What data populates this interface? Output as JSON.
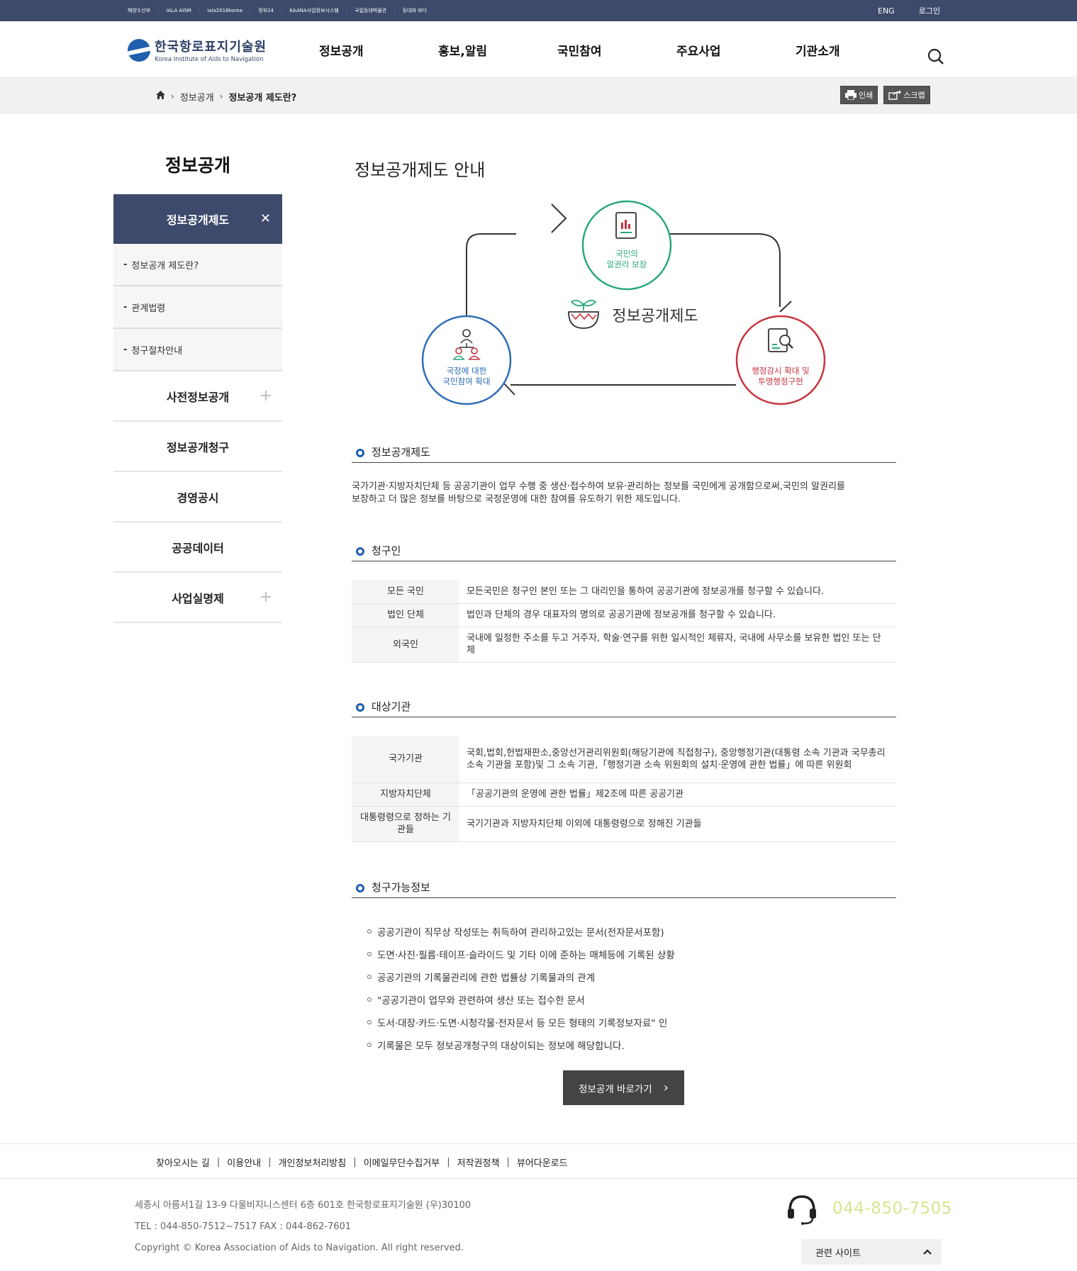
{
  "topbar": {
    "links": [
      "해양수산부",
      "IALA AISM",
      "iala2018korea",
      "정부24",
      "KAANA사업정보시스템",
      "국립등대박물관",
      "등대와 바다"
    ],
    "eng": "ENG",
    "login": "로그인"
  },
  "header": {
    "logo_ko": "한국항로표지기술원",
    "logo_en": "Korea Institute of Aids to Navigation",
    "nav": [
      "정보공개",
      "홍보,알림",
      "국민참여",
      "주요사업",
      "기관소개"
    ]
  },
  "breadcrumb": {
    "items": [
      "정보공개",
      "정보공개 제도란?"
    ],
    "print": "인쇄",
    "scrap": "스크랩"
  },
  "lnb": {
    "title": "정보공개",
    "active": "정보공개제도",
    "subs": [
      "정보공개 제도란?",
      "관계법령",
      "청구절차안내"
    ],
    "mains": [
      {
        "label": "사전정보공개",
        "expand": true
      },
      {
        "label": "정보공개청구",
        "expand": false
      },
      {
        "label": "경영공시",
        "expand": false
      },
      {
        "label": "공공데이터",
        "expand": false
      },
      {
        "label": "사업실명제",
        "expand": true
      }
    ]
  },
  "content": {
    "title": "정보공개제도 안내",
    "diagram": {
      "center": "정보공개제도",
      "top": [
        "국민의",
        "알권리 보장"
      ],
      "left": [
        "국정에 대한",
        "국민참여 확대"
      ],
      "right": [
        "행정감시 확대 및",
        "투명행정구현"
      ],
      "colors": {
        "top": "#2aa87a",
        "left": "#2d6db5",
        "right": "#c8333f",
        "line": "#333333"
      }
    },
    "sec1": {
      "title": "정보공개제도",
      "text_line1": "국가기관·지방자치단체 등 공공기관이 업무 수행 중 생산·접수하여 보유·관리하는 정보를 국민에게 공개함으로써,국민의 알권리를",
      "text_line2": "보장하고 더 많은 정보를 바탕으로 국정운영에 대한 참여를 유도하기 위한 제도입니다."
    },
    "sec2": {
      "title": "청구인",
      "rows": [
        {
          "th": "모든 국민",
          "td": "모든국민은 청구인 본인 또는 그 대리인을 통하여 공공기관에 정보공개를 청구할 수 있습니다."
        },
        {
          "th": "법인 단체",
          "td": "법인과 단체의 경우 대표자의 명의로 공공기관에 정보공개를 청구할 수 있습니다."
        },
        {
          "th": "외국인",
          "td": "국내에 일정한 주소를 두고 거주자, 학술·연구를 위한 일시적인 체류자, 국내에 사무소를 보유한 법인 또는 단체"
        }
      ]
    },
    "sec3": {
      "title": "대상기관",
      "rows": [
        {
          "th": "국가기관",
          "td": "국회,법회,헌법재판소,중앙선거관리위원회(해당기관에 직접청구), 중앙행정기관(대통령 소속 기관과 국무총리 소속 기관을 포함)및 그 소속 기관,「행정기관 소속 위원회의 설치·운영에 관한 법률」에 따른 위원회"
        },
        {
          "th": "지방자치단체",
          "td": "「공공기관의 운영에 관한 법률」제2조에 따른 공공기관"
        },
        {
          "th": "대통령령으로 정하는 기관들",
          "td": "국기기관과 지방자치단체 이외에 대통령령으로 정해진 기관들"
        }
      ]
    },
    "sec4": {
      "title": "청구가능정보",
      "items": [
        "공공기관이 직무상 작성또는 취득하여 관리하고있는 문서(전자문서포함)",
        "도면·사진·필름·테이프·슬라이드 및 기타 이에 준하는 매체등에 기록된 상황",
        "공공기관의 기록물관리에 관한 법률상 기록물과의 관계",
        "\"공공기관이 업무와 관련하여 생산 또는 접수한 문서",
        "도서·대장·카드·도면·시청각물·전자문서 등 모든 형태의 기록정보자료\" 인",
        "기록물은 모두 정보공개청구의 대상이되는 정보에 해당합니다."
      ]
    },
    "go_button": "정보공개 바로가기"
  },
  "footer": {
    "links": [
      "찾아오시는 길",
      "이용안내",
      "개인정보처리방침",
      "이메일무단수집거부",
      "저작권정책",
      "뷰어다운로드"
    ],
    "address": "세종시 아름서1길 13-9 다울비지니스센터 6층 601호 한국항로표지기술원 (우)30100",
    "tel": "TEL : 044-850-7512~7517 FAX : 044-862-7601",
    "copyright": "Copyright © Korea Association of Aids to Navigation. All right reserved.",
    "phone": "044-850-7505",
    "related": "관련 사이트"
  }
}
